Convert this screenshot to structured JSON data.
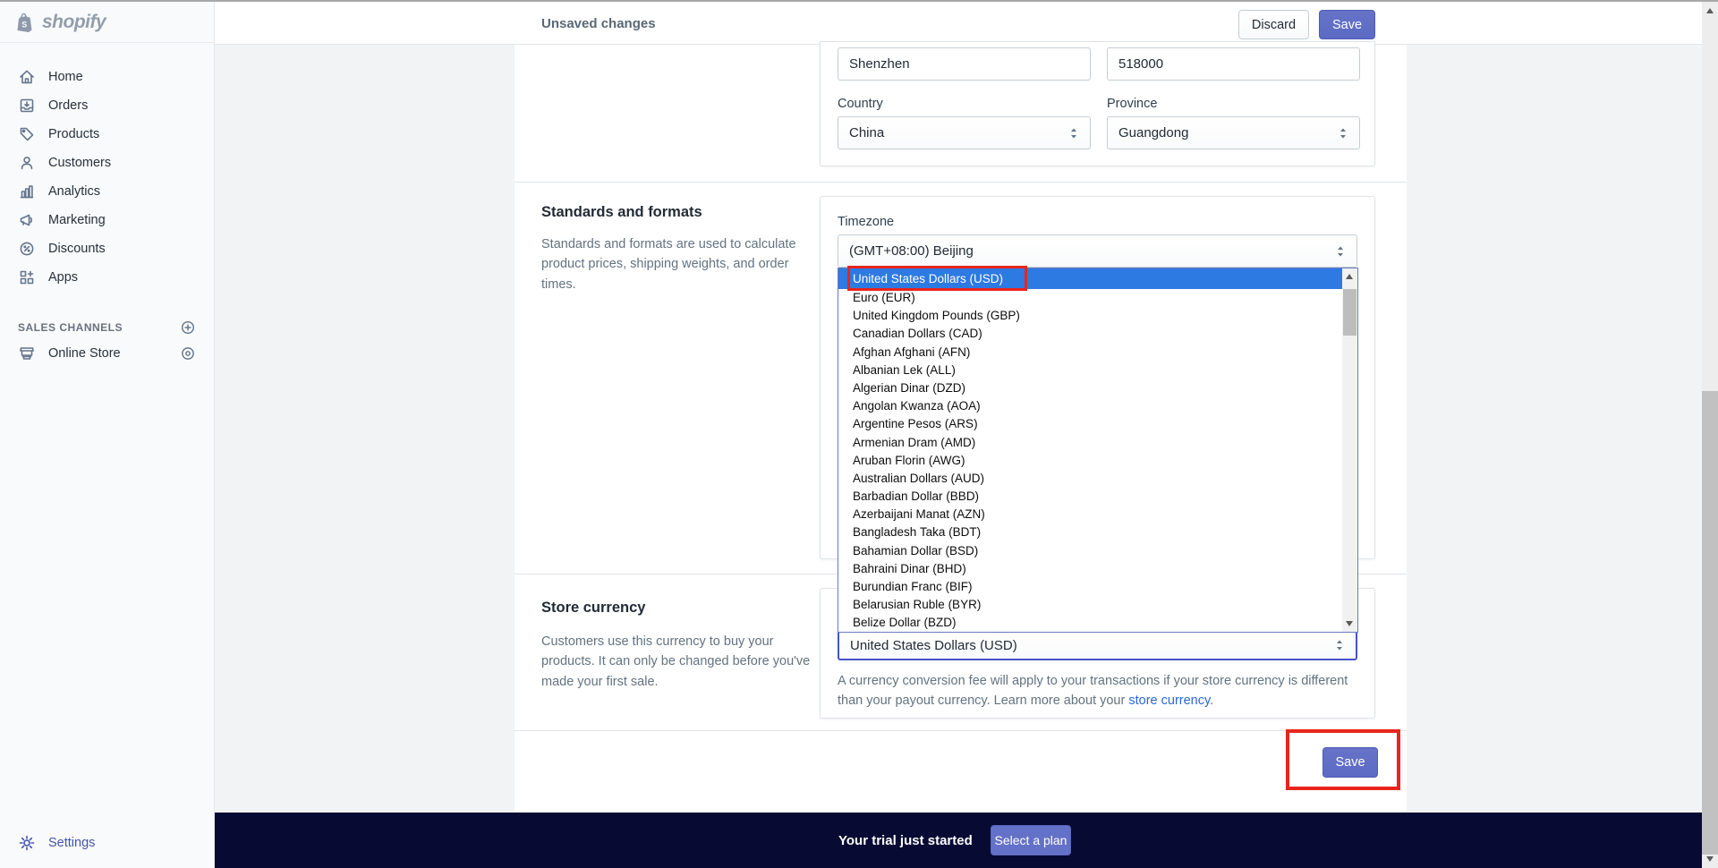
{
  "colors": {
    "accent_indigo": "#5c6ac4",
    "highlight_blue": "#2d7ae2",
    "annotation_red": "#e8251d",
    "trial_bar_bg": "#070b34",
    "link_blue": "#2a66d9"
  },
  "sidebar": {
    "logo_text": "shopify",
    "items": [
      {
        "label": "Home",
        "icon": "home-icon"
      },
      {
        "label": "Orders",
        "icon": "orders-icon"
      },
      {
        "label": "Products",
        "icon": "tag-icon"
      },
      {
        "label": "Customers",
        "icon": "person-icon"
      },
      {
        "label": "Analytics",
        "icon": "bar-chart-icon"
      },
      {
        "label": "Marketing",
        "icon": "megaphone-icon"
      },
      {
        "label": "Discounts",
        "icon": "discount-badge-icon"
      },
      {
        "label": "Apps",
        "icon": "apps-grid-icon"
      }
    ],
    "sales_channels_header": "SALES CHANNELS",
    "online_store_label": "Online Store",
    "settings_label": "Settings"
  },
  "topbar": {
    "message": "Unsaved changes",
    "discard_label": "Discard",
    "save_label": "Save"
  },
  "address_card": {
    "city_value": "Shenzhen",
    "zip_value": "518000",
    "country_label": "Country",
    "country_value": "China",
    "province_label": "Province",
    "province_value": "Guangdong"
  },
  "standards_section": {
    "heading": "Standards and formats",
    "description": "Standards and formats are used to calculate product prices, shipping weights, and order times.",
    "timezone_label": "Timezone",
    "timezone_value": "(GMT+08:00) Beijing"
  },
  "currency_dropdown": {
    "selected": "United States Dollars (USD)",
    "options": [
      "United States Dollars (USD)",
      "Euro (EUR)",
      "United Kingdom Pounds (GBP)",
      "Canadian Dollars (CAD)",
      "Afghan Afghani (AFN)",
      "Albanian Lek (ALL)",
      "Algerian Dinar (DZD)",
      "Angolan Kwanza (AOA)",
      "Argentine Pesos (ARS)",
      "Armenian Dram (AMD)",
      "Aruban Florin (AWG)",
      "Australian Dollars (AUD)",
      "Barbadian Dollar (BBD)",
      "Azerbaijani Manat (AZN)",
      "Bangladesh Taka (BDT)",
      "Bahamian Dollar (BSD)",
      "Bahraini Dinar (BHD)",
      "Burundian Franc (BIF)",
      "Belarusian Ruble (BYR)",
      "Belize Dollar (BZD)"
    ]
  },
  "store_currency_section": {
    "heading": "Store currency",
    "description": "Customers use this currency to buy your products. It can only be changed before you've made your first sale.",
    "currency_value": "United States Dollars (USD)",
    "note_before": "A currency conversion fee will apply to your transactions if your store currency is different than your payout currency. Learn more about your ",
    "note_link": "store currency",
    "note_after": "."
  },
  "bottom_save_label": "Save",
  "trial_bar": {
    "message": "Your trial just started",
    "button_label": "Select a plan"
  }
}
